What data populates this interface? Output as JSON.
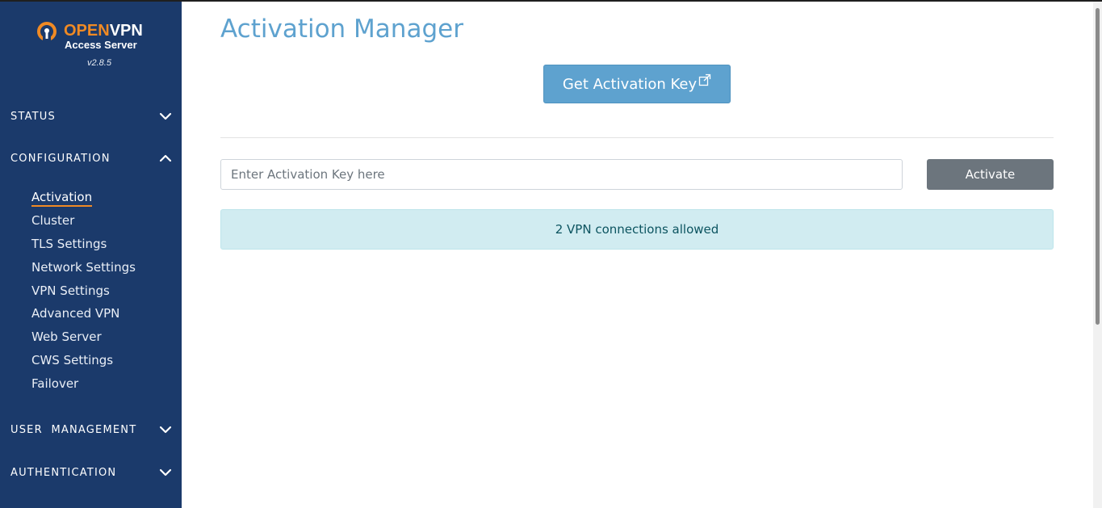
{
  "brand": {
    "name_open": "OPEN",
    "name_vpn": "VPN",
    "subtitle": "Access Server",
    "version": "v2.8.5",
    "accent_color": "#f08a24",
    "sidebar_color": "#1b3a6b"
  },
  "sidebar": {
    "sections": [
      {
        "label": "STATUS",
        "icon": "chevron-down-icon"
      },
      {
        "label": "CONFIGURATION",
        "icon": "chevron-up-icon"
      },
      {
        "label": "USER  MANAGEMENT",
        "icon": "chevron-down-icon"
      },
      {
        "label": "AUTHENTICATION",
        "icon": "chevron-down-icon"
      }
    ],
    "config_items": [
      {
        "label": "Activation",
        "active": true
      },
      {
        "label": "Cluster"
      },
      {
        "label": "TLS Settings"
      },
      {
        "label": "Network Settings"
      },
      {
        "label": "VPN Settings"
      },
      {
        "label": "Advanced VPN"
      },
      {
        "label": "Web Server"
      },
      {
        "label": "CWS Settings"
      },
      {
        "label": "Failover"
      }
    ]
  },
  "main": {
    "title": "Activation Manager",
    "get_key_label": "Get Activation Key",
    "get_key_icon": "external-link-icon",
    "key_input": {
      "placeholder": "Enter Activation Key here",
      "value": ""
    },
    "activate_label": "Activate",
    "info_message": "2 VPN connections allowed",
    "title_color": "#5ea2cf"
  }
}
